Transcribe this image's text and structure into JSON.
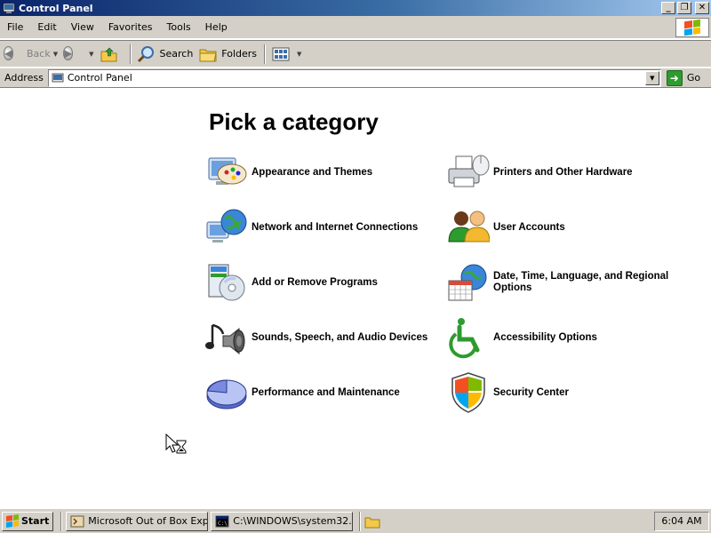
{
  "window": {
    "title": "Control Panel",
    "controls": [
      "minimize",
      "restore",
      "close"
    ]
  },
  "menubar": {
    "items": [
      "File",
      "Edit",
      "View",
      "Favorites",
      "Tools",
      "Help"
    ]
  },
  "toolbar": {
    "back_label": "Back",
    "search_label": "Search",
    "folders_label": "Folders"
  },
  "address": {
    "label": "Address",
    "value": "Control Panel",
    "go_label": "Go"
  },
  "main": {
    "heading": "Pick a category",
    "categories": [
      {
        "label": "Appearance and Themes",
        "icon": "appearance-themes-icon"
      },
      {
        "label": "Printers and Other Hardware",
        "icon": "printer-icon"
      },
      {
        "label": "Network and Internet Connections",
        "icon": "network-globe-icon"
      },
      {
        "label": "User Accounts",
        "icon": "user-accounts-icon"
      },
      {
        "label": "Add or Remove Programs",
        "icon": "add-remove-programs-icon"
      },
      {
        "label": "Date, Time, Language, and Regional Options",
        "icon": "date-time-globe-icon"
      },
      {
        "label": "Sounds, Speech, and Audio Devices",
        "icon": "speaker-note-icon"
      },
      {
        "label": "Accessibility Options",
        "icon": "accessibility-icon"
      },
      {
        "label": "Performance and Maintenance",
        "icon": "pie-chart-icon"
      },
      {
        "label": "Security Center",
        "icon": "shield-icon"
      }
    ]
  },
  "taskbar": {
    "start_label": "Start",
    "tasks": [
      {
        "label": "Microsoft Out of Box Exp...",
        "icon": "oobe-icon"
      },
      {
        "label": "C:\\WINDOWS\\system32...",
        "icon": "cmd-icon"
      }
    ],
    "clock": "6:04 AM"
  },
  "colors": {
    "titlebar_start": "#0a246a",
    "titlebar_end": "#a6caf0",
    "chrome": "#d4d0c8"
  }
}
